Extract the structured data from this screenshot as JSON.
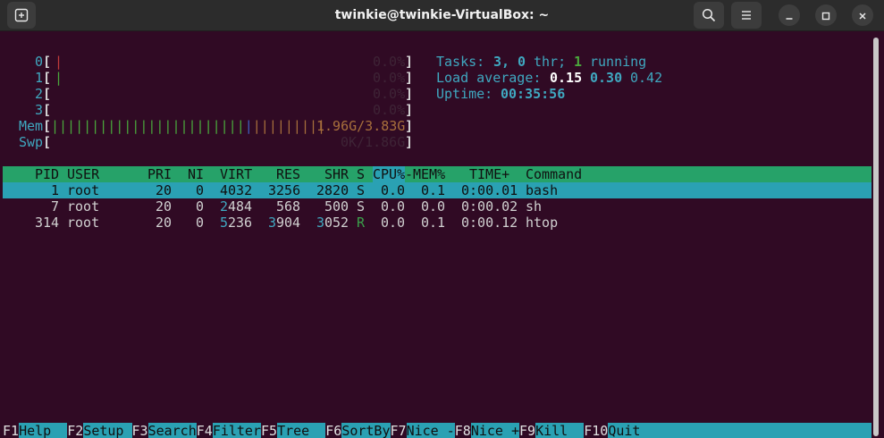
{
  "window": {
    "title": "twinkie@twinkie-VirtualBox: ~"
  },
  "colors": {
    "terminal_bg": "#300a24",
    "header_green": "#26a269",
    "selection_cyan": "#2aa1b3"
  },
  "icons": {
    "new_tab": "new-tab-icon",
    "search": "search-icon",
    "menu": "hamburger-menu-icon",
    "minimize": "minimize-icon",
    "maximize": "maximize-icon",
    "close": "close-icon"
  },
  "meters": {
    "cpus": [
      {
        "label": "0",
        "value": "0.0%"
      },
      {
        "label": "1",
        "value": "0.0%"
      },
      {
        "label": "2",
        "value": "0.0%"
      },
      {
        "label": "3",
        "value": "0.0%"
      }
    ],
    "mem": {
      "label": "Mem",
      "value": "1.96G/3.83G"
    },
    "swp": {
      "label": "Swp",
      "value": "0K/1.86G"
    }
  },
  "summary": {
    "tasks_label": "Tasks:",
    "tasks_count": "3,",
    "thr_count": "0",
    "thr_label": "thr;",
    "running_count": "1",
    "running_label": "running",
    "load_label": "Load average:",
    "load_1": "0.15",
    "load_5": "0.30",
    "load_15": "0.42",
    "uptime_label": "Uptime:",
    "uptime_value": "00:35:56"
  },
  "table": {
    "columns": {
      "pid": "PID",
      "user": "USER",
      "pri": "PRI",
      "ni": "NI",
      "virt": "VIRT",
      "res": "RES",
      "shr": "SHR",
      "s": "S",
      "cpu": "CPU%",
      "mem": "MEM%",
      "time": "TIME+",
      "command": "Command"
    },
    "rows": [
      {
        "pid": "1",
        "user": "root",
        "pri": "20",
        "ni": "0",
        "virt": "4032",
        "res": "3256",
        "shr": "2820",
        "s": "S",
        "cpu": "0.0",
        "mem": "0.1",
        "time": "0:00.01",
        "command": "bash"
      },
      {
        "pid": "7",
        "user": "root",
        "pri": "20",
        "ni": "0",
        "virt_hi": "2",
        "virt_lo": "484",
        "res": "568",
        "shr": "500",
        "s": "S",
        "cpu": "0.0",
        "mem": "0.0",
        "time": "0:00.02",
        "command": "sh"
      },
      {
        "pid": "314",
        "user": "root",
        "pri": "20",
        "ni": "0",
        "virt_hi": "5",
        "virt_lo": "236",
        "res_hi": "3",
        "res_lo": "904",
        "shr_hi": "3",
        "shr_lo": "052",
        "s": "R",
        "cpu": "0.0",
        "mem": "0.1",
        "time": "0:00.12",
        "command": "htop"
      }
    ]
  },
  "function_keys": [
    {
      "key": "F1",
      "label": "Help"
    },
    {
      "key": "F2",
      "label": "Setup"
    },
    {
      "key": "F3",
      "label": "Search"
    },
    {
      "key": "F4",
      "label": "Filter"
    },
    {
      "key": "F5",
      "label": "Tree"
    },
    {
      "key": "F6",
      "label": "SortBy"
    },
    {
      "key": "F7",
      "label": "Nice -"
    },
    {
      "key": "F8",
      "label": "Nice +"
    },
    {
      "key": "F9",
      "label": "Kill"
    },
    {
      "key": "F10",
      "label": "Quit"
    }
  ]
}
